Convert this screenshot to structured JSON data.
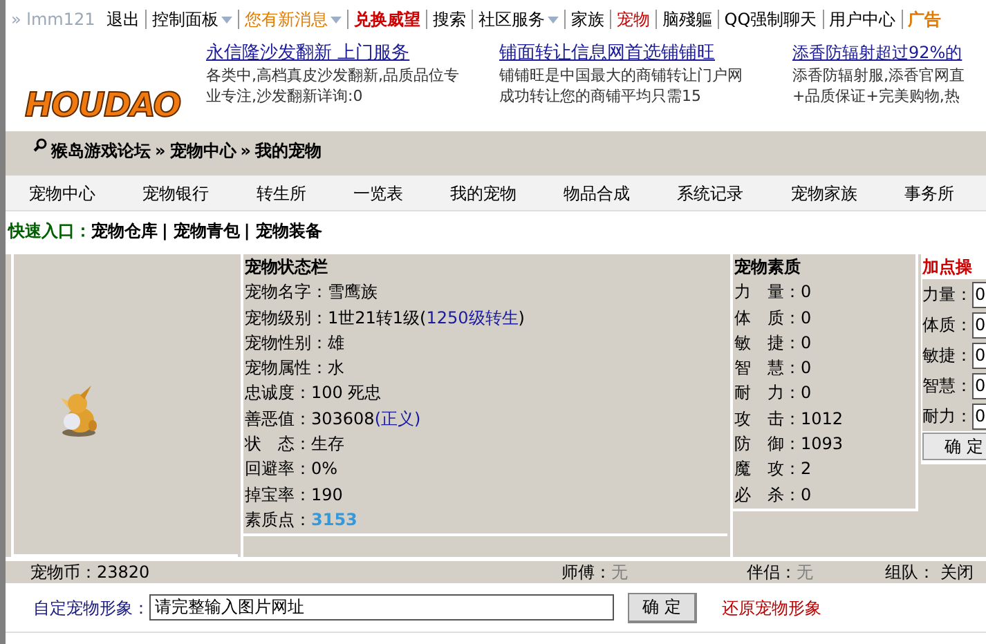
{
  "top_nav": [
    {
      "label": "» lmm121",
      "kind": "user",
      "dropdown": false
    },
    {
      "label": "退出",
      "kind": "plain",
      "dropdown": false
    },
    {
      "label": "控制面板",
      "kind": "plain",
      "dropdown": true
    },
    {
      "label": "您有新消息",
      "kind": "notice",
      "dropdown": true
    },
    {
      "label": "兑换威望",
      "kind": "alert",
      "dropdown": false
    },
    {
      "label": "搜索",
      "kind": "plain",
      "dropdown": false
    },
    {
      "label": "社区服务",
      "kind": "plain",
      "dropdown": true
    },
    {
      "label": "家族",
      "kind": "plain",
      "dropdown": false
    },
    {
      "label": "宠物",
      "kind": "active",
      "dropdown": false
    },
    {
      "label": "脑殘軀",
      "kind": "plain",
      "dropdown": false
    },
    {
      "label": "QQ强制聊天",
      "kind": "plain",
      "dropdown": false
    },
    {
      "label": "用户中心",
      "kind": "plain",
      "dropdown": false
    },
    {
      "label": "广告",
      "kind": "ad",
      "dropdown": false
    }
  ],
  "logo": "HOUDAO",
  "ads": [
    {
      "title": "永信隆沙发翻新 上门服务",
      "lines": [
        "各类中,高档真皮沙发翻新,品质品位专",
        "业专注,沙发翻新详询:0"
      ]
    },
    {
      "title": "铺面转让信息网首选铺铺旺",
      "lines": [
        "铺铺旺是中国最大的商铺转让门户网",
        "成功转让您的商铺平均只需15"
      ]
    },
    {
      "title": "添香防辐射超过92%的",
      "lines": [
        "添香防辐射服,添香官网直",
        "+品质保证+完美购物,热"
      ]
    }
  ],
  "breadcrumb": {
    "separator": "»",
    "items": [
      "猴岛游戏论坛",
      "宠物中心",
      "我的宠物"
    ]
  },
  "tabs": [
    {
      "label": "宠物中心",
      "selected": false
    },
    {
      "label": "宠物银行",
      "selected": false
    },
    {
      "label": "转生所",
      "selected": false
    },
    {
      "label": "一览表",
      "selected": false
    },
    {
      "label": "我的宠物",
      "selected": false
    },
    {
      "label": "物品合成",
      "selected": false
    },
    {
      "label": "系统记录",
      "selected": false
    },
    {
      "label": "宠物家族",
      "selected": false
    },
    {
      "label": "事务所",
      "selected": false
    }
  ],
  "quick_entry": {
    "label": "快速入口：",
    "separator": "|",
    "links": [
      "宠物仓库",
      "宠物青包",
      "宠物装备"
    ]
  },
  "status": {
    "title": "宠物状态栏",
    "rows": [
      {
        "label": "宠物名字：",
        "parts": [
          {
            "text": "雪鹰族",
            "kind": "plain"
          }
        ]
      },
      {
        "label": "宠物级别：",
        "parts": [
          {
            "text": "1世21转1级(",
            "kind": "plain"
          },
          {
            "text": "1250级转生",
            "kind": "link"
          },
          {
            "text": ")",
            "kind": "plain"
          }
        ]
      },
      {
        "label": "宠物性别：",
        "parts": [
          {
            "text": "雄",
            "kind": "plain"
          }
        ]
      },
      {
        "label": "宠物属性：",
        "parts": [
          {
            "text": "水",
            "kind": "plain"
          }
        ]
      },
      {
        "label": "忠诚度：",
        "parts": [
          {
            "text": "100 死忠",
            "kind": "plain"
          }
        ]
      },
      {
        "label": "善恶值：",
        "parts": [
          {
            "text": "303608",
            "kind": "plain"
          },
          {
            "text": "(正义)",
            "kind": "link"
          }
        ]
      },
      {
        "label": "状　态：",
        "parts": [
          {
            "text": "生存",
            "kind": "plain"
          }
        ]
      },
      {
        "label": "回避率：",
        "parts": [
          {
            "text": "0%",
            "kind": "plain"
          }
        ]
      },
      {
        "label": "掉宝率：",
        "parts": [
          {
            "text": "190",
            "kind": "plain"
          }
        ]
      },
      {
        "label": "素质点：",
        "parts": [
          {
            "text": "3153",
            "kind": "highlight"
          }
        ]
      }
    ]
  },
  "quality": {
    "title": "宠物素质",
    "rows": [
      {
        "label": "力　量：",
        "value": "0"
      },
      {
        "label": "体　质：",
        "value": "0"
      },
      {
        "label": "敏　捷：",
        "value": "0"
      },
      {
        "label": "智　慧：",
        "value": "0"
      },
      {
        "label": "耐　力：",
        "value": "0"
      },
      {
        "label": "攻　击：",
        "value": "1012"
      },
      {
        "label": "防　御：",
        "value": "1093"
      },
      {
        "label": "魔　攻：",
        "value": "2"
      },
      {
        "label": "必　杀：",
        "value": "0"
      }
    ]
  },
  "add_points": {
    "title": "加点操",
    "fields": [
      {
        "label": "力量：",
        "value": "0"
      },
      {
        "label": "体质：",
        "value": "0"
      },
      {
        "label": "敏捷：",
        "value": "0"
      },
      {
        "label": "智慧：",
        "value": "0"
      },
      {
        "label": "耐力：",
        "value": "0"
      }
    ],
    "button": "确 定"
  },
  "info_bar": [
    {
      "label": "宠物币：",
      "value": "23820",
      "kind": "plain"
    },
    {
      "label": "师傅：",
      "value": "无",
      "kind": "empty"
    },
    {
      "label": "伴侣：",
      "value": "无",
      "kind": "empty"
    },
    {
      "label": "组队： ",
      "value": "关闭",
      "kind": "plain"
    }
  ],
  "custom_image": {
    "label": "自定宠物形象：",
    "value": "请完整输入图片网址",
    "button": "确 定",
    "reset_link": "还原宠物形象"
  }
}
